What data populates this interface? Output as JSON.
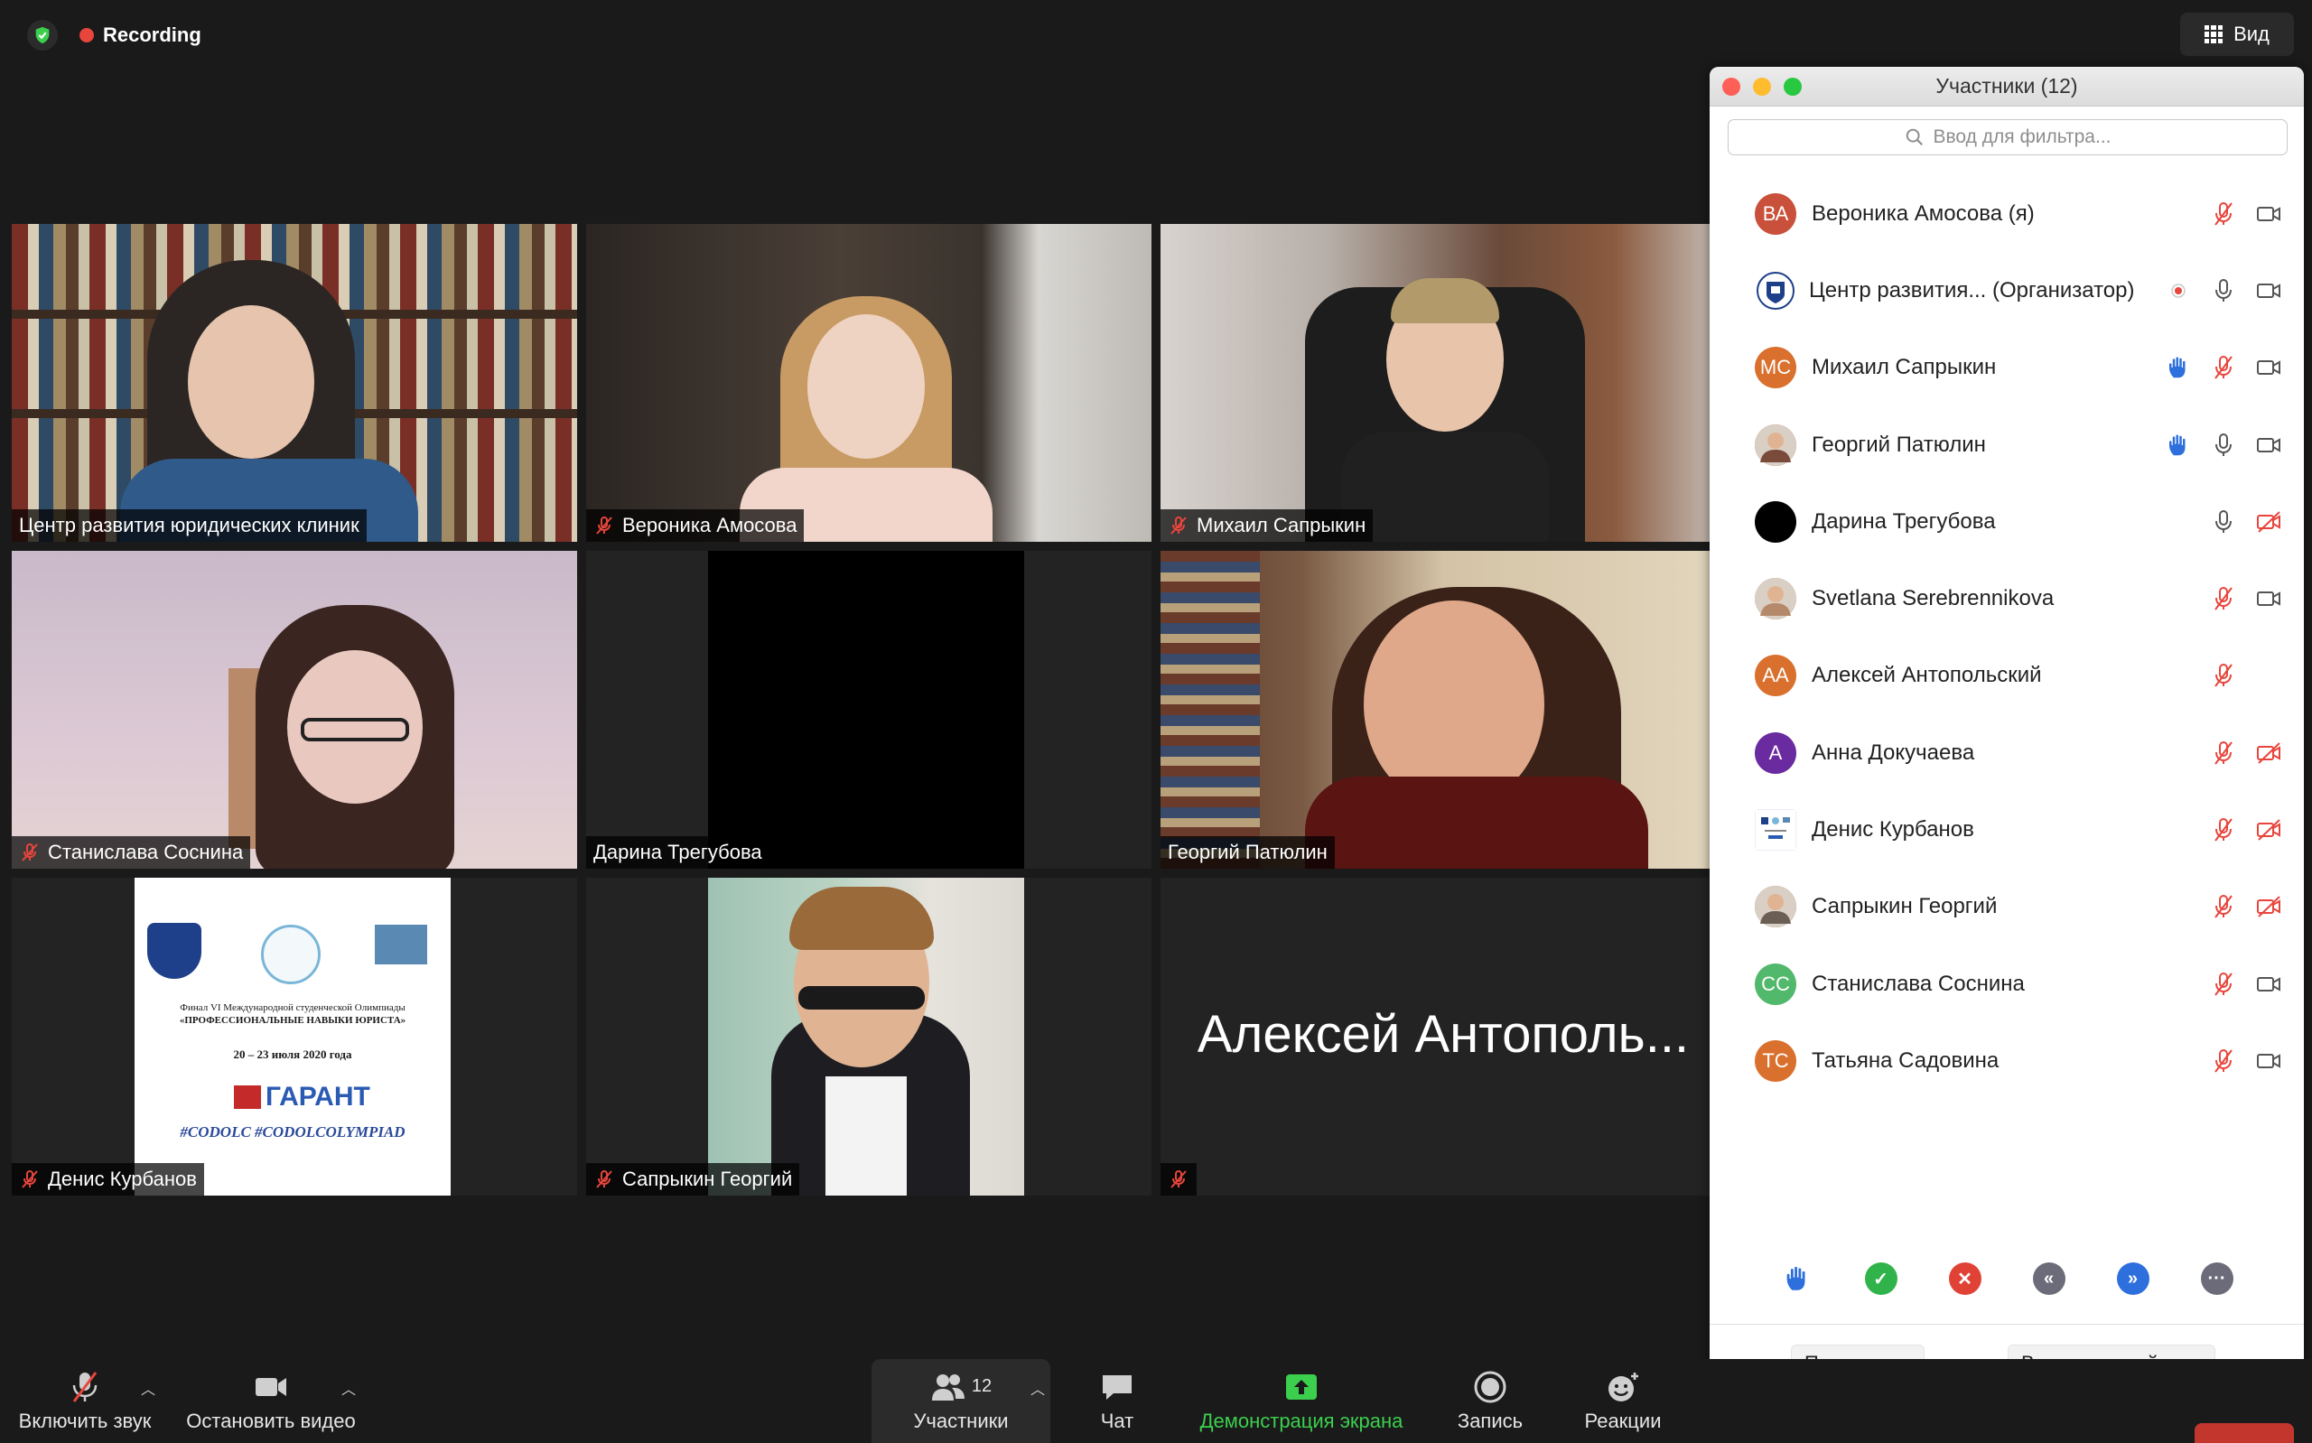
{
  "topbar": {
    "recording_label": "Recording",
    "view_label": "Вид"
  },
  "tiles": [
    {
      "name": "Центр развития юридических клиник",
      "muted": false
    },
    {
      "name": "Вероника Амосова",
      "muted": true
    },
    {
      "name": "Михаил Сапрыкин",
      "muted": true
    },
    {
      "name": "Станислава Соснина",
      "muted": true
    },
    {
      "name": "Дарина Трегубова",
      "muted": false
    },
    {
      "name": "Георгий Патюлин",
      "muted": false,
      "active_speaker": true
    },
    {
      "name": "Денис Курбанов",
      "muted": true
    },
    {
      "name": "Сапрыкин Георгий",
      "muted": true
    },
    {
      "name": "",
      "muted": true,
      "display_name": "Алексей Антополь..."
    }
  ],
  "slide": {
    "line1": "Финал VI Международной студенческой Олимпиады",
    "line2": "«ПРОФЕССИОНАЛЬНЫЕ НАВЫКИ ЮРИСТА»",
    "dates": "20 – 23 июля 2020 года",
    "brand": "ГАРАНТ",
    "hashtags": "#CODOLC #CODOLCOLYMPIAD"
  },
  "panel": {
    "title": "Участники (12)",
    "search_placeholder": "Ввод для фильтра...",
    "participants": [
      {
        "initials": "ВА",
        "name": "Вероника Амосова (я)",
        "avatar_color": "#c9503a",
        "hand": false,
        "mic": "muted",
        "video": "on"
      },
      {
        "initials": "",
        "name": "Центр развития...   (Организатор)",
        "avatar_color": "#ffffff",
        "avatar_kind": "emblem",
        "hand": false,
        "rec": true,
        "mic": "on",
        "video": "on"
      },
      {
        "initials": "МС",
        "name": "Михаил Сапрыкин",
        "avatar_color": "#d9702e",
        "hand": true,
        "mic": "muted",
        "video": "on"
      },
      {
        "initials": "",
        "name": "Георгий Патюлин",
        "avatar_color": "#7a4a3a",
        "avatar_kind": "photo",
        "hand": true,
        "mic": "on",
        "video": "on"
      },
      {
        "initials": "",
        "name": "Дарина Трегубова",
        "avatar_color": "#000000",
        "hand": false,
        "mic": "on",
        "video": "off"
      },
      {
        "initials": "",
        "name": "Svetlana Serebrennikova",
        "avatar_color": "#b58a6a",
        "avatar_kind": "photo",
        "hand": false,
        "mic": "muted",
        "video": "on"
      },
      {
        "initials": "АА",
        "name": "Алексей Антопольский",
        "avatar_color": "#d9702e",
        "hand": false,
        "mic": "muted",
        "video": "none"
      },
      {
        "initials": "А",
        "name": "Анна Докучаева",
        "avatar_color": "#6a2aa0",
        "hand": false,
        "mic": "muted",
        "video": "off"
      },
      {
        "initials": "",
        "name": "Денис Курбанов",
        "avatar_color": "#e8eef5",
        "avatar_kind": "thumb",
        "hand": false,
        "mic": "muted",
        "video": "off"
      },
      {
        "initials": "",
        "name": "Сапрыкин Георгий",
        "avatar_color": "#6b5e55",
        "avatar_kind": "photo",
        "hand": false,
        "mic": "muted",
        "video": "off"
      },
      {
        "initials": "СС",
        "name": "Станислава Соснина",
        "avatar_color": "#52b86b",
        "hand": false,
        "mic": "muted",
        "video": "on"
      },
      {
        "initials": "ТС",
        "name": "Татьяна Садовина",
        "avatar_color": "#d9702e",
        "hand": false,
        "mic": "muted",
        "video": "on"
      }
    ],
    "invite_label": "Пригласить",
    "unmute_self_label": "Включить свой звук"
  },
  "toolbar": {
    "audio_label": "Включить звук",
    "video_label": "Остановить видео",
    "participants_label": "Участники",
    "participants_count": "12",
    "chat_label": "Чат",
    "share_label": "Демонстрация экрана",
    "record_label": "Запись",
    "reactions_label": "Реакции"
  },
  "colors": {
    "accent_green": "#3ccf4e",
    "recording_red": "#e8453c",
    "active_outline": "#d6d16e",
    "raise_hand_blue": "#2d6fdc"
  }
}
